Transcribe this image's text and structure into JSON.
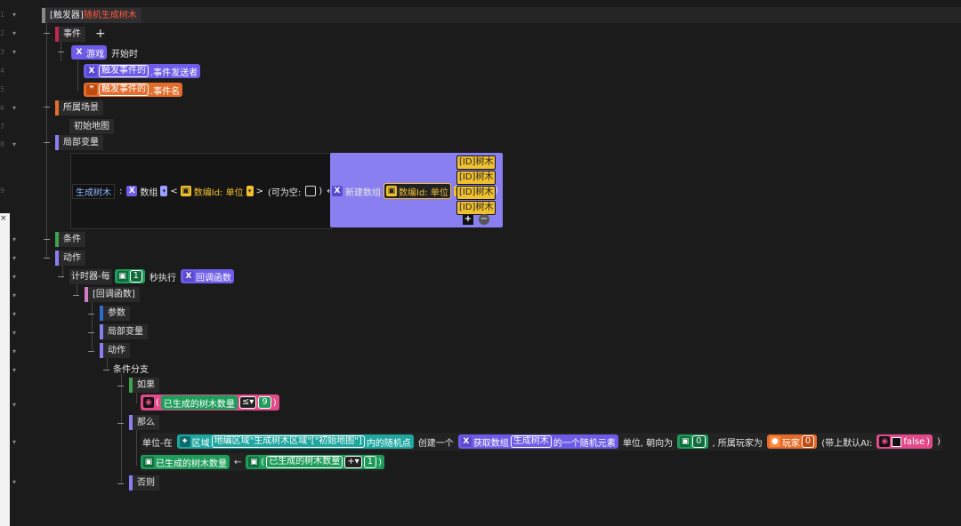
{
  "gutter": {
    "line_numbers": [
      "1",
      "2",
      "3",
      "4",
      "5",
      "6",
      "7",
      "8",
      "9"
    ],
    "fold_marks": [
      "▾",
      "▾",
      "▾",
      "▾",
      "▾",
      "▾",
      "▾",
      "▾",
      "▾",
      "▾",
      "▾",
      "▾",
      "▾",
      "▾",
      "▾",
      "▾"
    ],
    "close_icon": "×"
  },
  "trigger": {
    "tag": "[触发器]",
    "name": "随机生成树木"
  },
  "event": {
    "label": "事件",
    "add_icon": "+",
    "game_chip": "游戏",
    "start_text": "开始时",
    "param1_chip": "触发事件的",
    "param1_text": ".事件发送者",
    "param2_chip": "触发事件的",
    "param2_text": ".事件名"
  },
  "scene": {
    "label": "所属场景",
    "value": "初始地图"
  },
  "local_var": {
    "label": "局部变量",
    "name": "生成树木",
    "colon": ":",
    "array": "数组",
    "lt": "<",
    "elem_type": "数编Id: 单位",
    "gt": ">",
    "nullable": "(可为空:",
    "nullable_close": ")",
    "assign": "←",
    "new_array": "新建数组",
    "new_type": "数编Id: 单位",
    "paren_open": "(",
    "paren_close": ")",
    "items": [
      "[ID]树木",
      "[ID]树木",
      "[ID]树木",
      "[ID]树木"
    ],
    "add": "+",
    "remove": "−"
  },
  "condition": {
    "label": "条件"
  },
  "action": {
    "label": "动作",
    "timer_prefix": "计时器-每",
    "timer_value": "1",
    "timer_suffix": "秒执行",
    "callback_chip": "回调函数",
    "callback_label": "[回调函数]",
    "params_label": "参数",
    "locals_label": "局部变量",
    "actions_label": "动作",
    "branch_label": "条件分支",
    "if_label": "如果",
    "if_paren_open": "(",
    "if_var": "已生成的树木数量",
    "if_op": "≤▾",
    "if_value": "9",
    "if_paren_close": ")",
    "then_label": "那么",
    "unit_prefix": "单位-在",
    "region_chip": "区域",
    "region_value": "地编区域\"生成树木区域\"[\"初始地图\"]",
    "random_point": "内的随机点",
    "create_one": "创建一个",
    "get_array": "获取数组",
    "array_name": "生成树木",
    "random_elem": "的一个随机元素",
    "facing_text": "单位, 朝向为",
    "facing_value": "0",
    "player_text": ", 所属玩家为",
    "player_chip": "玩家",
    "player_value": "0",
    "ai_text": "(带上默认AI:",
    "ai_value": "false",
    "ai_close": ")",
    "tail_paren": ")",
    "assign_var": "已生成的树木数量",
    "assign_arrow": "←",
    "assign_paren_open": "(",
    "assign_src": "已生成的树木数量",
    "assign_op": "+▾",
    "assign_value": "1",
    "assign_paren_close": ")",
    "else_label": "否则"
  },
  "colors": {
    "background": "#1b1b1c",
    "purple": "#6c5ce7",
    "orange": "#e36d2b",
    "green": "#1e9c5a",
    "teal": "#1fa7a0",
    "pink": "#e34a8a",
    "lavender": "#8a7ff0",
    "yellow": "#f0c030"
  }
}
